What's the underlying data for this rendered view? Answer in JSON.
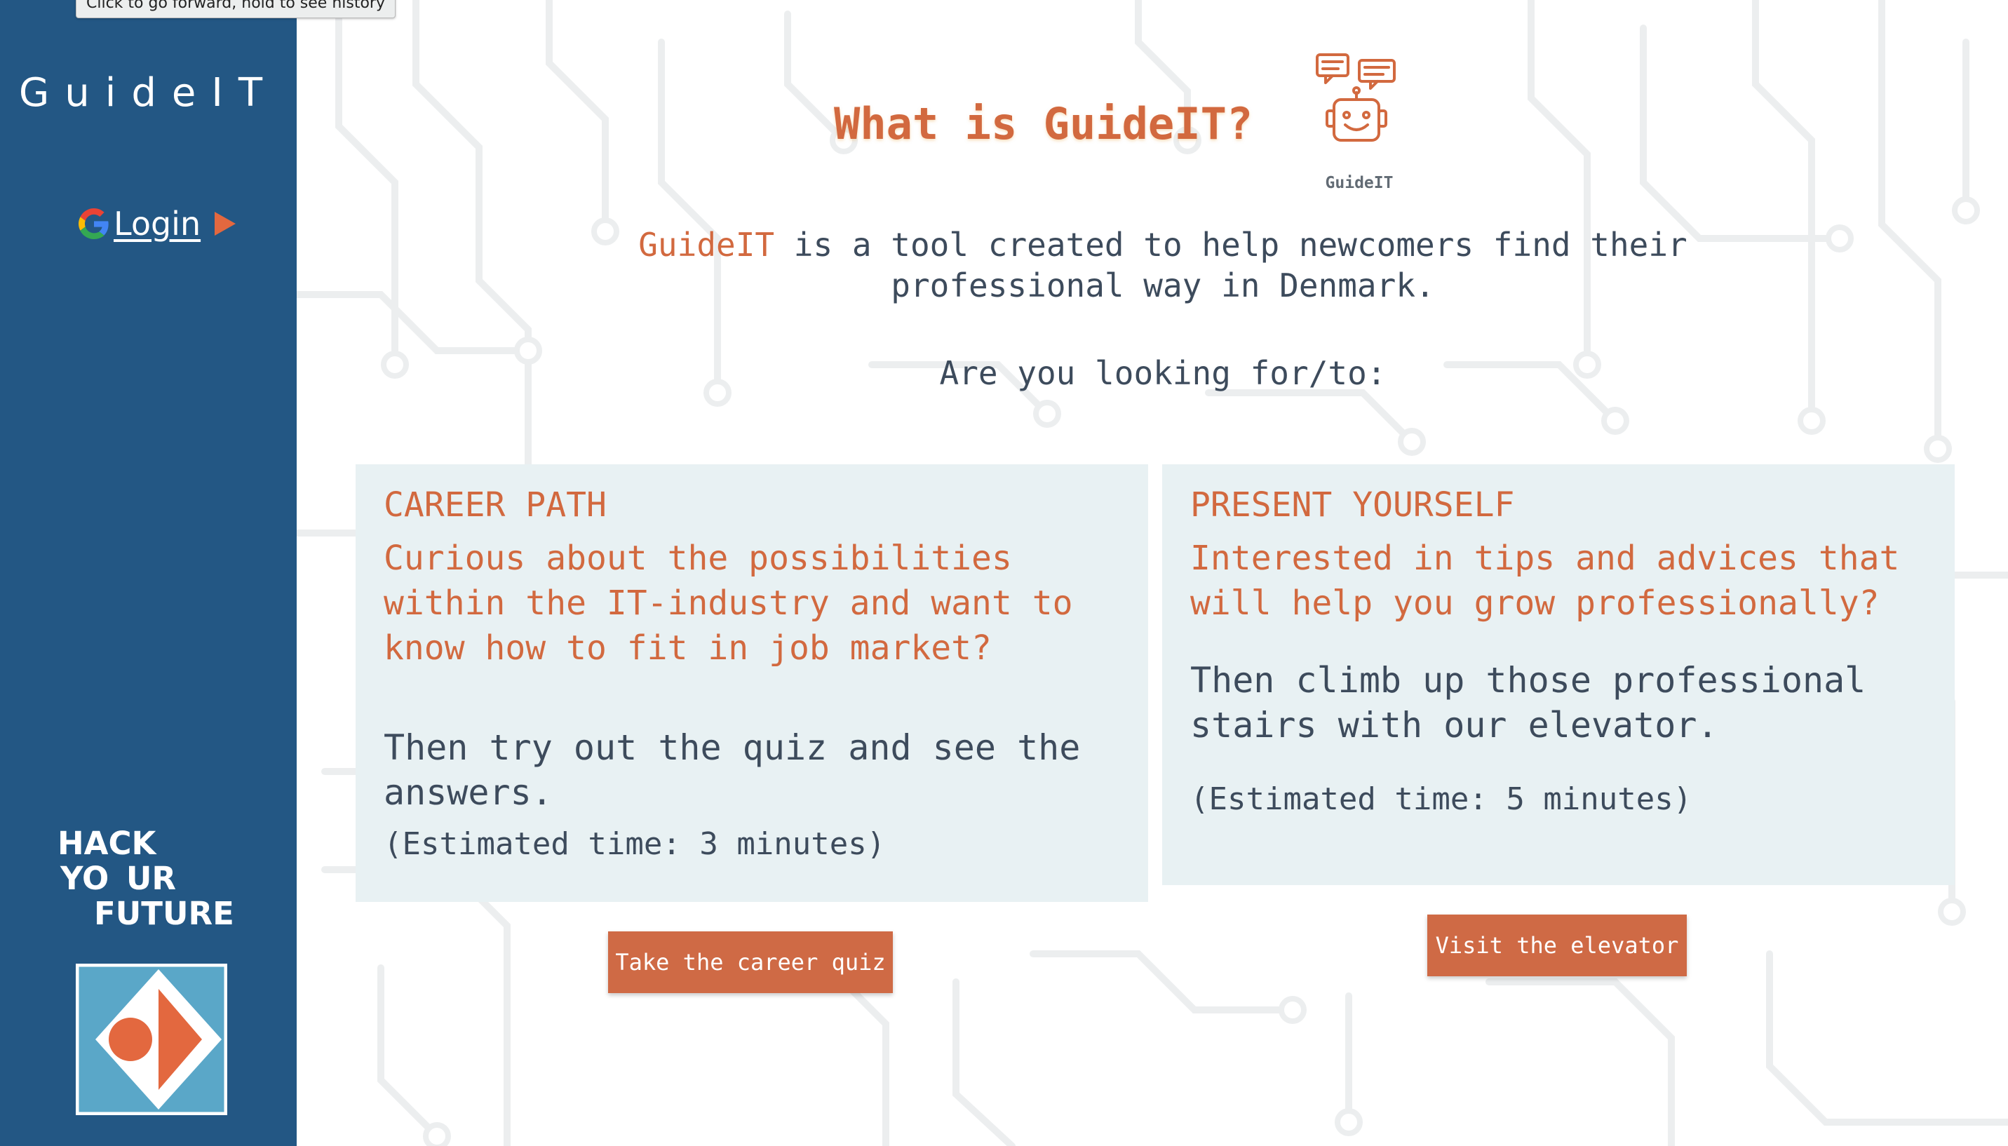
{
  "tooltip": {
    "text": "Click to go forward, hold to see history"
  },
  "sidebar": {
    "brand": "GuideIT",
    "login_label": "Login",
    "hyf": {
      "line1": "HACK",
      "line2": "YO  UR",
      "line3": "FUTURE"
    }
  },
  "main": {
    "title": "What is GuideIT?",
    "robot_caption": "GuideIT",
    "intro_accent": "GuideIT",
    "intro_rest": " is a tool created to help newcomers find their professional way in Denmark.",
    "question": "Are you looking for/to:"
  },
  "cards": {
    "career": {
      "heading": "CAREER PATH",
      "lead": "Curious about the possibilities within the IT-industry and want to know how to fit in job market?",
      "body": "Then try out the quiz and see the answers.",
      "time": "(Estimated time: 3 minutes)",
      "button": "Take the career quiz"
    },
    "present": {
      "heading": "PRESENT YOURSELF",
      "lead": "Interested in tips and advices that will help you grow professionally?",
      "body": "Then climb up those professional stairs with our elevator.",
      "time": "(Estimated time: 5 minutes)",
      "button": "Visit the elevator"
    }
  },
  "colors": {
    "sidebar": "#235784",
    "accent": "#d2693f",
    "button": "#cf6a45",
    "card_bg": "#e8f1f3",
    "text": "#3d4b5c",
    "logo_blue": "#5aa7c8",
    "logo_orange": "#e3683f"
  },
  "icons": [
    "google-icon",
    "play-arrow-icon",
    "robot-chat-icon",
    "hyf-logo-icon"
  ]
}
